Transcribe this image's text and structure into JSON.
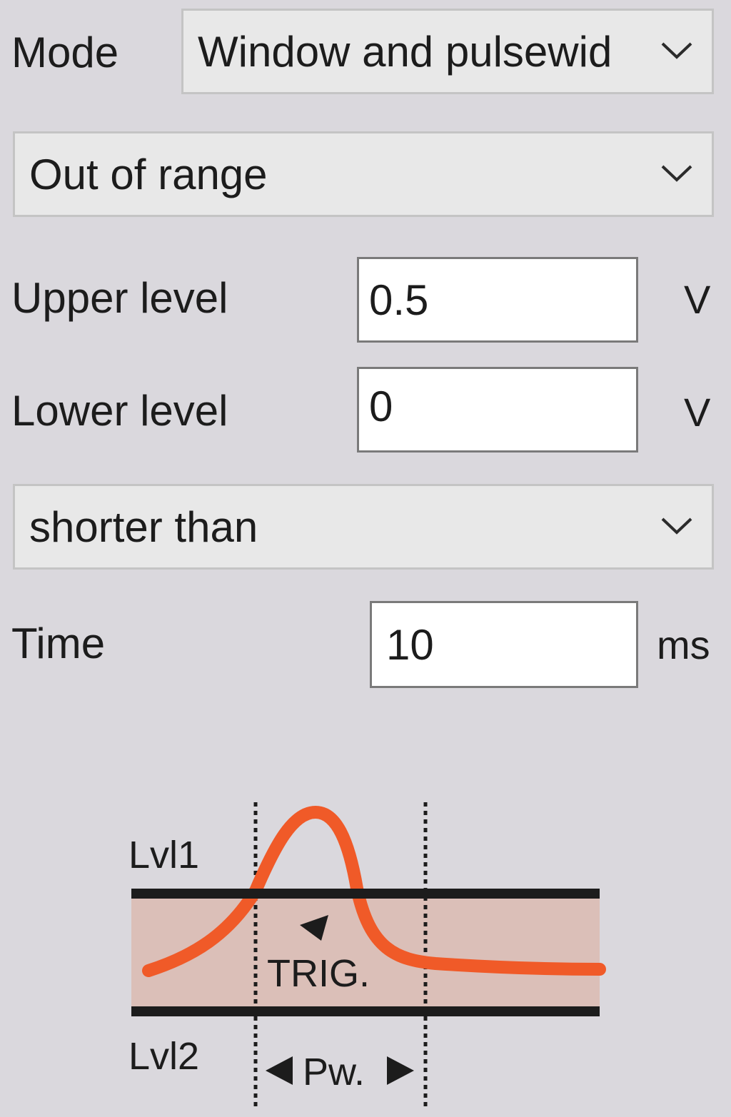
{
  "mode": {
    "label": "Mode",
    "value": "Window and pulsewid"
  },
  "range_select": {
    "value": "Out of range"
  },
  "upper_level": {
    "label": "Upper level",
    "value": "0.5",
    "unit": "V"
  },
  "lower_level": {
    "label": "Lower level",
    "value": "0",
    "unit": "V"
  },
  "duration_select": {
    "value": "shorter than"
  },
  "time": {
    "label": "Time",
    "value": "10",
    "unit": "ms"
  },
  "diagram": {
    "level1_label": "Lvl1",
    "level2_label": "Lvl2",
    "trigger_label": "TRIG.",
    "pulsewidth_label": "Pw.",
    "colors": {
      "signal": "#f05a28",
      "band": "#dbbfb8",
      "level_lines": "#1c1c1c"
    }
  },
  "icons": {
    "combo_chevron": "chevron-down-icon",
    "trigger_arrow": "arrow-left-icon",
    "pulsewidth_arrows": [
      "arrow-left-icon",
      "arrow-right-icon"
    ]
  }
}
